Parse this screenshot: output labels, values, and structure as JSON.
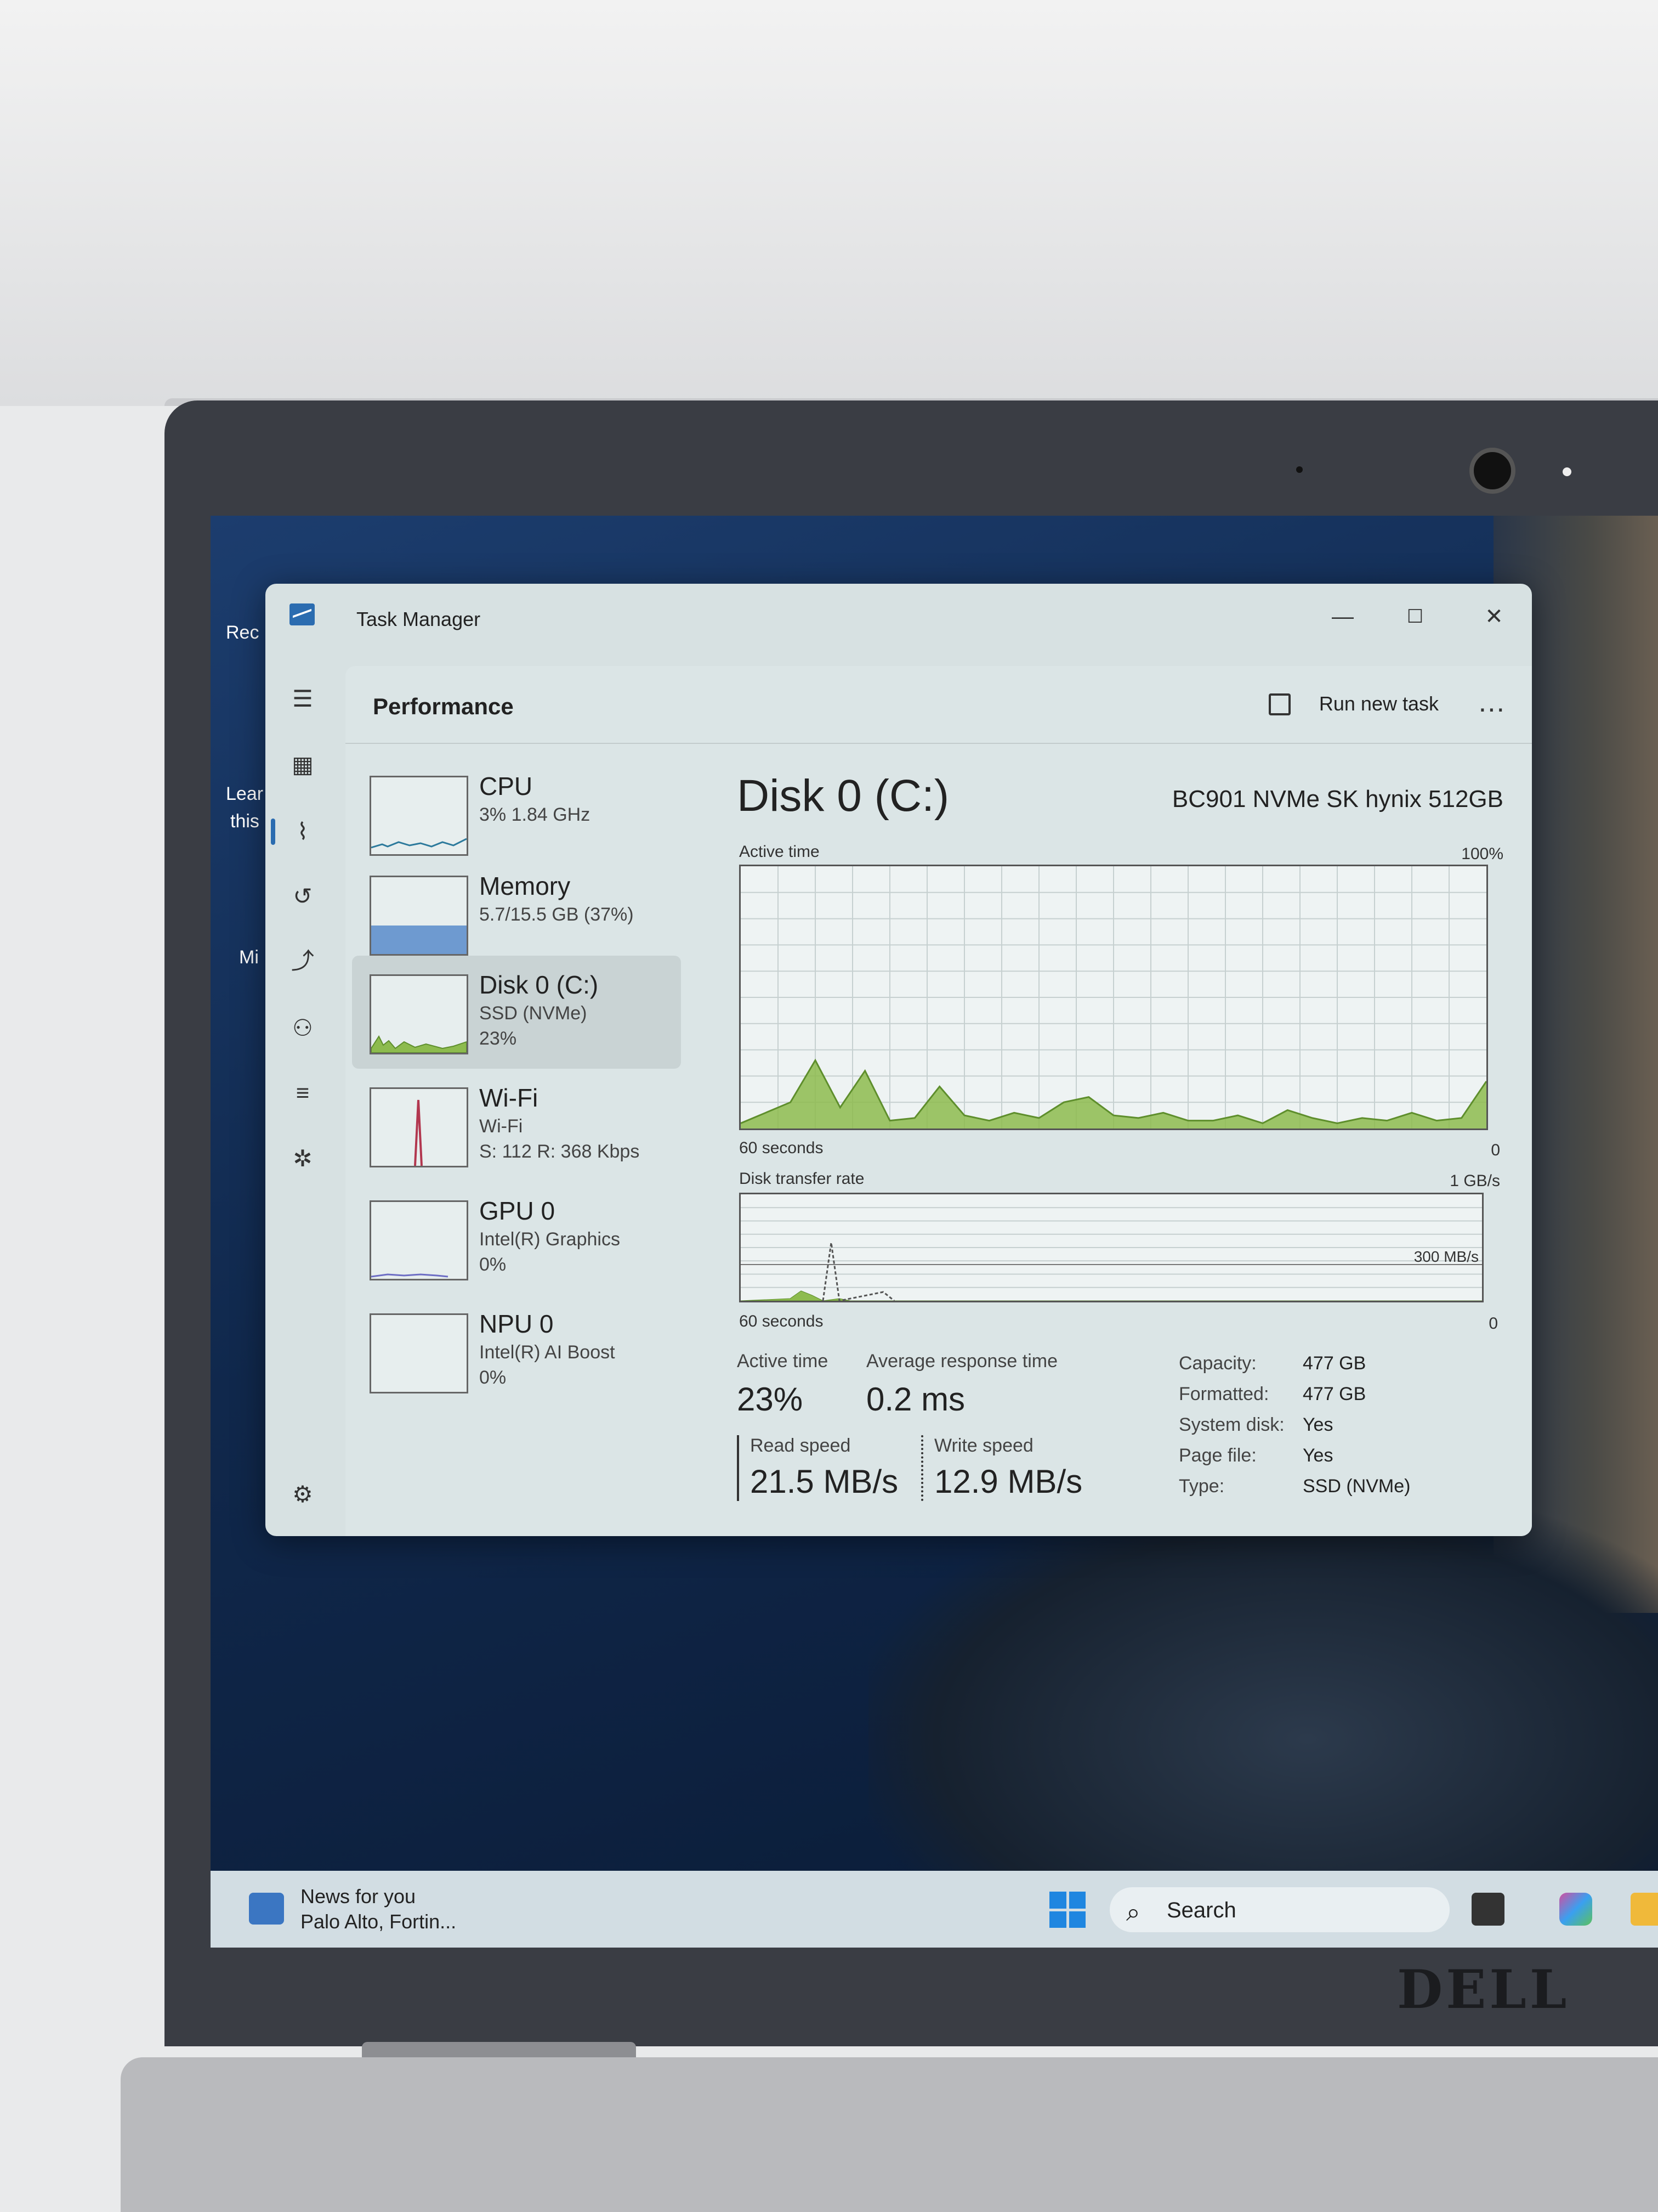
{
  "window": {
    "title": "Task Manager",
    "min_glyph": "—",
    "max_glyph": "☐",
    "close_glyph": "✕"
  },
  "header": {
    "title": "Performance",
    "run_new_task": "Run new task",
    "more": "..."
  },
  "nav": [
    {
      "icon": "hamburger-icon"
    },
    {
      "icon": "processes-icon"
    },
    {
      "icon": "performance-icon",
      "active": true
    },
    {
      "icon": "app-history-icon"
    },
    {
      "icon": "startup-apps-icon"
    },
    {
      "icon": "users-icon"
    },
    {
      "icon": "details-icon"
    },
    {
      "icon": "services-icon"
    },
    {
      "icon": "settings-icon"
    }
  ],
  "devices": [
    {
      "name": "CPU",
      "line1": "3% 1.84 GHz",
      "line2": ""
    },
    {
      "name": "Memory",
      "line1": "5.7/15.5 GB (37%)",
      "line2": ""
    },
    {
      "name": "Disk 0 (C:)",
      "line1": "SSD (NVMe)",
      "line2": "23%"
    },
    {
      "name": "Wi-Fi",
      "line1": "Wi-Fi",
      "line2": "S: 112 R: 368 Kbps"
    },
    {
      "name": "GPU 0",
      "line1": "Intel(R) Graphics",
      "line2": "0%"
    },
    {
      "name": "NPU 0",
      "line1": "Intel(R) AI Boost",
      "line2": "0%"
    }
  ],
  "detail": {
    "title": "Disk 0 (C:)",
    "model": "BC901 NVMe SK hynix 512GB",
    "active_time_label": "Active time",
    "active_time_max": "100%",
    "graph1_xlabel": "60 seconds",
    "graph1_zero": "0",
    "transfer_label": "Disk transfer rate",
    "transfer_max": "1 GB/s",
    "transfer_mid": "300 MB/s",
    "graph2_xlabel": "60 seconds",
    "graph2_zero": "0",
    "stats": {
      "active_time_label": "Active time",
      "active_time_value": "23%",
      "avg_response_label": "Average response time",
      "avg_response_value": "0.2 ms",
      "read_speed_label": "Read speed",
      "read_speed_value": "21.5 MB/s",
      "write_speed_label": "Write speed",
      "write_speed_value": "12.9 MB/s"
    },
    "props": [
      {
        "k": "Capacity:",
        "v": "477 GB"
      },
      {
        "k": "Formatted:",
        "v": "477 GB"
      },
      {
        "k": "System disk:",
        "v": "Yes"
      },
      {
        "k": "Page file:",
        "v": "Yes"
      },
      {
        "k": "Type:",
        "v": "SSD (NVMe)"
      }
    ]
  },
  "chart_data": {
    "type": "area",
    "title": "Active time",
    "x": [
      0,
      2,
      4,
      6,
      8,
      10,
      12,
      14,
      16,
      18,
      20,
      22,
      24,
      26,
      28,
      30,
      32,
      34,
      36,
      38,
      40,
      42,
      44,
      46,
      48,
      50,
      52,
      54,
      56,
      58,
      60
    ],
    "series": [
      {
        "values": [
          2,
          6,
          10,
          26,
          8,
          22,
          3,
          4,
          16,
          5,
          3,
          6,
          4,
          10,
          12,
          5,
          4,
          6,
          3,
          3,
          5,
          2,
          7,
          4,
          2,
          4,
          3,
          6,
          3,
          4,
          18
        ]
      }
    ],
    "ylim": [
      0,
      100
    ]
  },
  "desktop": {
    "icon1_label": "Rec",
    "icon2_label_a": "Lear",
    "icon2_label_b": "this",
    "icon3_label": "Mi"
  },
  "taskbar": {
    "news_title": "News for you",
    "news_sub": "Palo Alto, Fortin...",
    "search": "Search"
  },
  "brand": "DELL",
  "colors": {
    "accent_disk": "#8dbb4e",
    "disk_line": "#5e8e2c",
    "cpu_line": "#2d7a9c",
    "memory_fill": "#6e9ad0",
    "wifi_line": "#b2374f",
    "gpu_line": "#6d6dc4"
  }
}
